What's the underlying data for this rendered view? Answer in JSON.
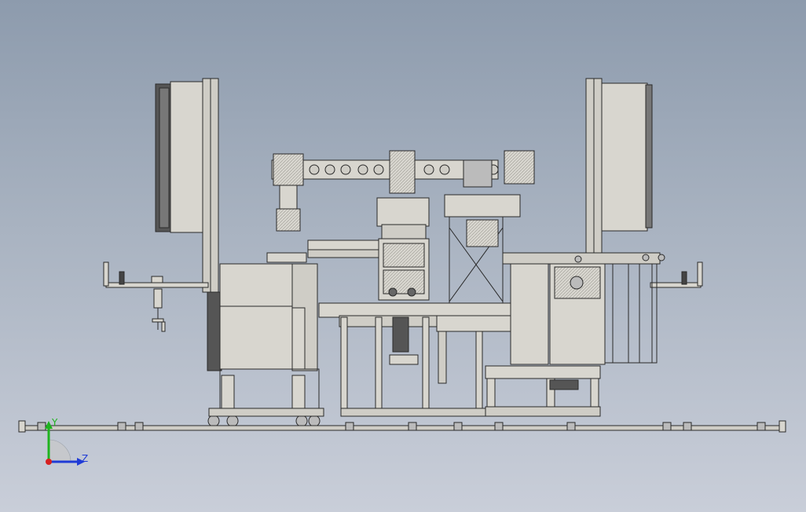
{
  "view": {
    "background_top": "#8d9bad",
    "background_bottom": "#c9ced9",
    "model_fill": "#d8d6cf",
    "model_line": "#2a2a2a"
  },
  "triad": {
    "y_label": "Y",
    "z_label": "Z",
    "y_color": "#1fb31f",
    "z_color": "#1f3bd6",
    "x_color": "#d62020"
  }
}
